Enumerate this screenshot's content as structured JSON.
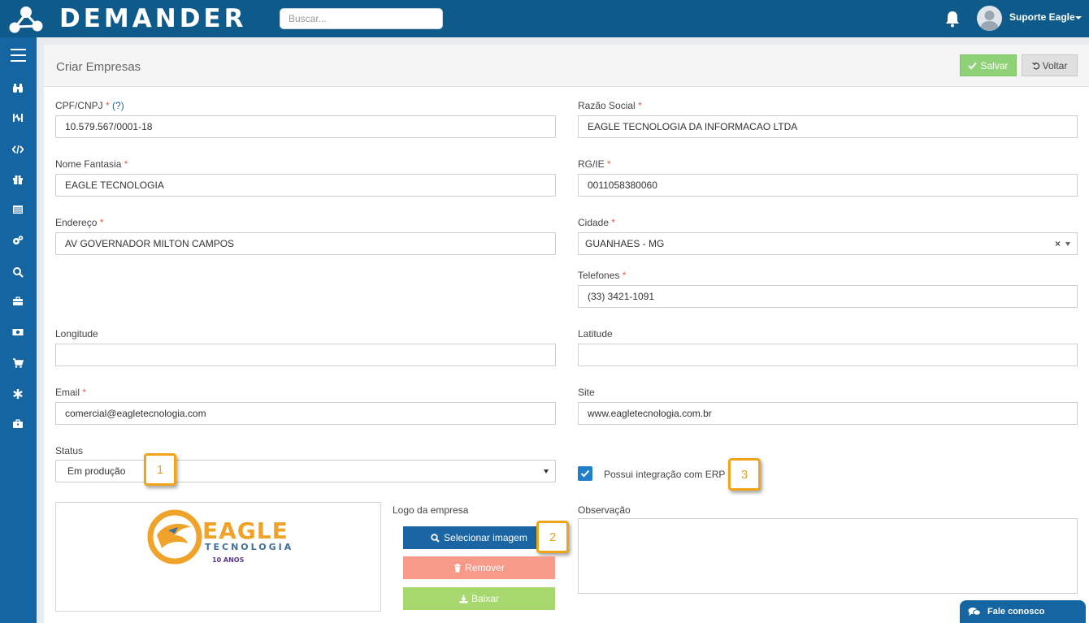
{
  "app": {
    "brand": "DEMANDER",
    "search_placeholder": "Buscar...",
    "user_name": "Suporte Eagle"
  },
  "sidebar": {
    "icons": [
      "menu-icon",
      "binoculars-icon",
      "heartbeat-icon",
      "code-icon",
      "gift-icon",
      "list-icon",
      "cogs-icon",
      "search-icon",
      "briefcase-icon",
      "money-icon",
      "cart-icon",
      "asterisk-icon",
      "suitcase-icon"
    ]
  },
  "page": {
    "title": "Criar Empresas",
    "save_label": "Salvar",
    "back_label": "Voltar"
  },
  "form": {
    "cpf_label": "CPF/CNPJ",
    "cpf_hint": "(?)",
    "cpf_value": "10.579.567/0001-18",
    "razao_label": "Razão Social",
    "razao_value": "EAGLE TECNOLOGIA DA INFORMACAO LTDA",
    "fantasia_label": "Nome Fantasia",
    "fantasia_value": "EAGLE TECNOLOGIA",
    "rg_label": "RG/IE",
    "rg_value": "0011058380060",
    "endereco_label": "Endereço",
    "endereco_value": "AV GOVERNADOR MILTON CAMPOS",
    "cidade_label": "Cidade",
    "cidade_value": "GUANHAES - MG",
    "telefones_label": "Telefones",
    "telefones_value": "(33) 3421-1091",
    "longitude_label": "Longitude",
    "longitude_value": "",
    "latitude_label": "Latitude",
    "latitude_value": "",
    "email_label": "Email",
    "email_value": "comercial@eagletecnologia.com",
    "site_label": "Site",
    "site_value": "www.eagletecnologia.com.br",
    "status_label": "Status",
    "status_value": "Em produção",
    "erp_label": "Possui integração com ERP",
    "erp_checked": true,
    "logo_label": "Logo da empresa",
    "select_image_label": "Selecionar imagem",
    "remove_label": "Remover",
    "download_label": "Baixar",
    "observacao_label": "Observação",
    "observacao_value": "",
    "required_mark": "*"
  },
  "logo_image": {
    "name": "EAGLE",
    "sub": "TECNOLOGIA",
    "badge": "10 ANOS"
  },
  "callouts": [
    "1",
    "2",
    "3"
  ],
  "chat": {
    "label": "Fale conosco"
  },
  "colors": {
    "topbar": "#0e5a8a",
    "sidebar": "#1565a3",
    "save": "#8fd177",
    "primary": "#1b65a5",
    "danger": "#f89a8a",
    "success": "#a6d86e",
    "callout": "#f0a417",
    "required": "#e85b4e"
  }
}
